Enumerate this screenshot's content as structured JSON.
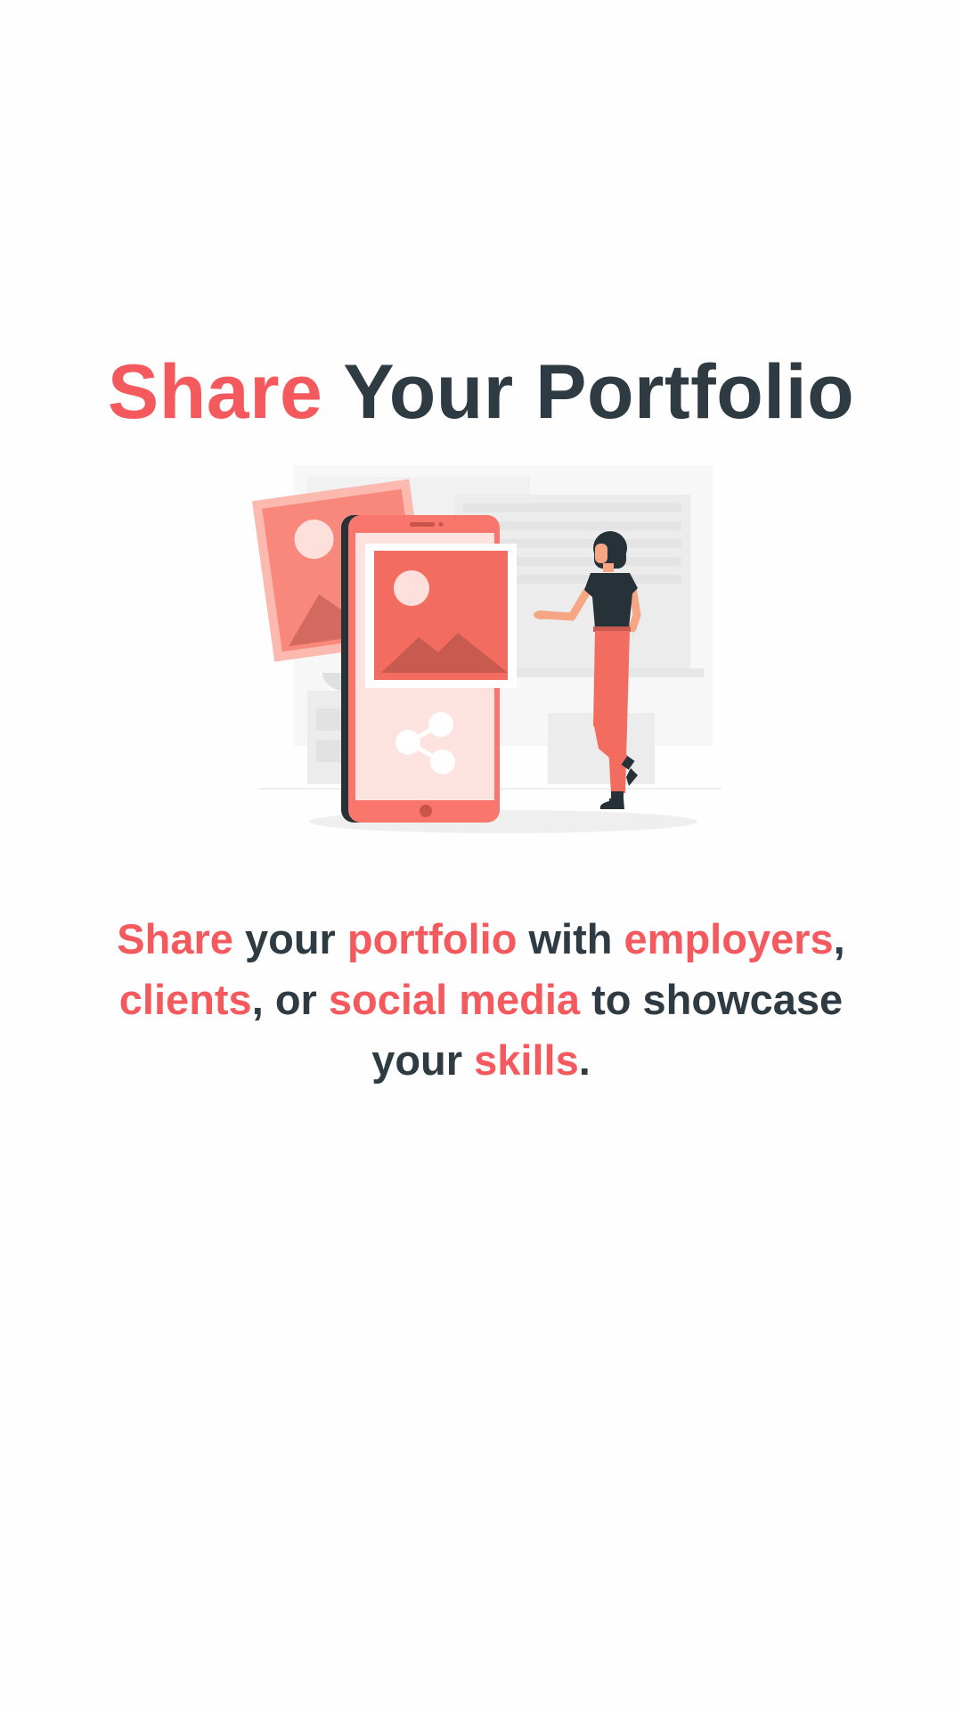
{
  "colors": {
    "accent": "#f45a5d",
    "text_dark": "#2f3b43",
    "background": "#fefefe"
  },
  "title": {
    "highlight": "Share",
    "rest": "Your Portfolio"
  },
  "illustration": {
    "icon": "share-portfolio-illustration"
  },
  "description": {
    "w1": "Share",
    "w2": " your ",
    "w3": "portfolio",
    "w4": " with ",
    "w5": "employers",
    "w6": ", ",
    "w7": "clients",
    "w8": ", or ",
    "w9": "social media",
    "w10": " to showcase your ",
    "w11": "skills",
    "w12": "."
  }
}
